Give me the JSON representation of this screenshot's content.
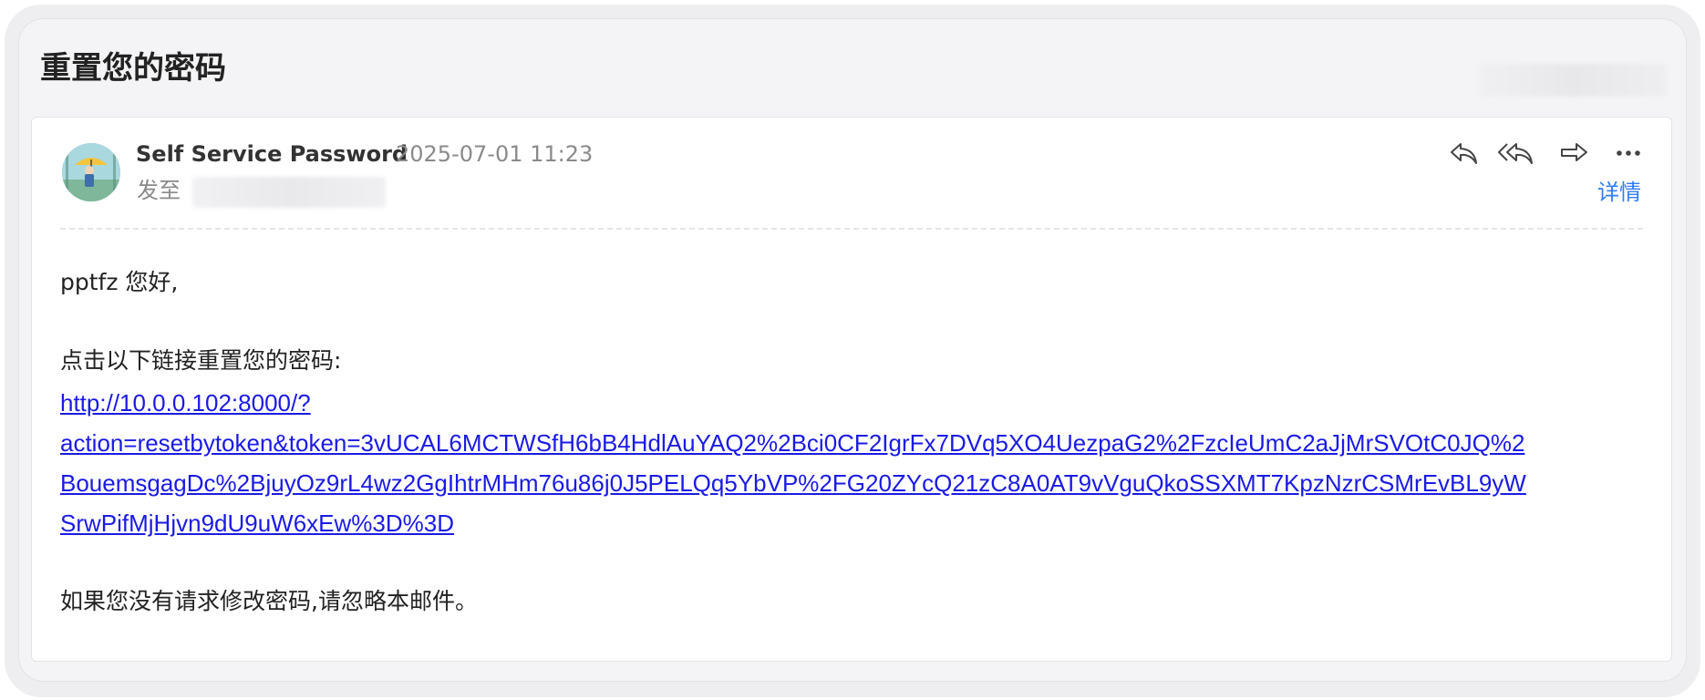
{
  "email": {
    "subject": "重置您的密码",
    "sender_name": "Self Service Password",
    "sent_time": "2025-07-01 11:23",
    "to_label": "发至",
    "details_label": "详情",
    "actions": [
      {
        "name": "reply",
        "icon": "reply-icon"
      },
      {
        "name": "reply-all",
        "icon": "reply-all-icon"
      },
      {
        "name": "forward",
        "icon": "forward-icon"
      },
      {
        "name": "more",
        "icon": "more-icon"
      }
    ],
    "body": {
      "greeting": "pptfz 您好,",
      "instruction": "点击以下链接重置您的密码:",
      "reset_link": "http://10.0.0.102:8000/?action=resetbytoken&token=3vUCAL6MCTWSfH6bB4HdlAuYAQ2%2Bci0CF2IgrFx7DVq5XO4UezpaG2%2FzcIeUmC2aJjMrSVOtC0JQ%2BouemsgagDc%2BjuyOz9rL4wz2GgIhtrMHm76u86j0J5PELQq5YbVP%2FG20ZYcQ21zC8A0AT9vVguQkoSSXMT7KpzNzrCSMrEvBL9yWSrwPifMjHjvn9dU9uW6xEw%3D%3D",
      "reset_link_lines": [
        "http://10.0.0.102:8000/?",
        "action=resetbytoken&token=3vUCAL6MCTWSfH6bB4HdlAuYAQ2%2Bci0CF2IgrFx7DVq5XO4UezpaG2%2FzcIeUmC2aJjMrSVOtC0JQ%2",
        "BouemsgagDc%2BjuyOz9rL4wz2GgIhtrMHm76u86j0J5PELQq5YbVP%2FG20ZYcQ21zC8A0AT9vVguQkoSSXMT7KpzNzrCSMrEvBL9yW",
        "SrwPifMjHjvn9dU9uW6xEw%3D%3D"
      ],
      "footer": "如果您没有请求修改密码,请忽略本邮件。"
    }
  },
  "colors": {
    "link": "#1a1ae6",
    "details_link": "#2f7cf6",
    "muted_text": "#8a8a8a",
    "window_bg": "#f4f4f6",
    "card_bg": "#ffffff"
  }
}
